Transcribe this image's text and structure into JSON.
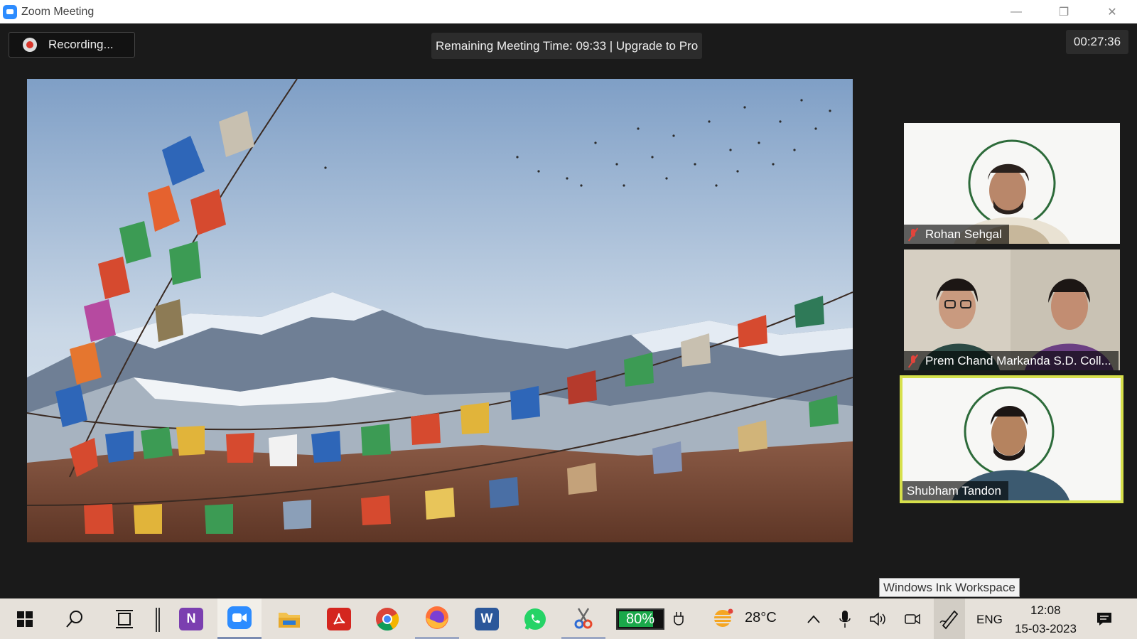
{
  "window": {
    "title": "Zoom Meeting"
  },
  "meeting": {
    "recording_label": "Recording...",
    "remaining_time": "Remaining Meeting Time: 09:33 | Upgrade to Pro",
    "elapsed_time": "00:27:36"
  },
  "participants": [
    {
      "name": "Rohan Sehgal",
      "muted": true,
      "active_speaker": false
    },
    {
      "name": "Prem Chand Markanda S.D. Coll...",
      "muted": true,
      "active_speaker": false
    },
    {
      "name": "Shubham Tandon",
      "muted": false,
      "active_speaker": true
    }
  ],
  "tooltip": "Windows Ink Workspace",
  "taskbar": {
    "apps": [
      "start-icon",
      "search-icon",
      "task-view-icon",
      "onenote-icon",
      "zoom-icon",
      "file-explorer-icon",
      "acrobat-icon",
      "chrome-icon",
      "firefox-icon",
      "word-icon",
      "whatsapp-icon",
      "snipping-tool-icon"
    ],
    "battery_percent": "80%",
    "battery_level": 0.8,
    "weather_temp": "28°C",
    "language": "ENG",
    "time": "12:08",
    "date": "15-03-2023"
  },
  "colors": {
    "zoom_blue": "#2d8cff",
    "active_speaker_border": "#d7e04b",
    "muted_red": "#e2443b",
    "battery_green": "#1aa84a"
  }
}
